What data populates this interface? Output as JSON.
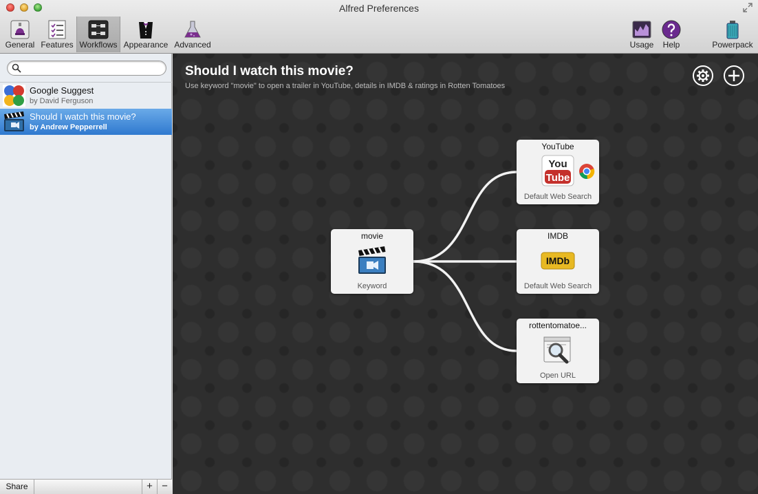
{
  "window": {
    "title": "Alfred Preferences"
  },
  "toolbar": {
    "general": "General",
    "features": "Features",
    "workflows": "Workflows",
    "appearance": "Appearance",
    "advanced": "Advanced",
    "usage": "Usage",
    "help": "Help",
    "powerpack": "Powerpack",
    "selected": "workflows"
  },
  "sidebar": {
    "search": {
      "value": "",
      "placeholder": ""
    },
    "items": [
      {
        "name": "Google Suggest",
        "author": "by David Ferguson"
      },
      {
        "name": "Should I watch this movie?",
        "author": "by Andrew Pepperrell",
        "selected": true
      }
    ],
    "share_label": "Share",
    "add_label": "+",
    "remove_label": "−"
  },
  "workflow": {
    "title": "Should I watch this movie?",
    "description": "Use keyword \"movie\" to open a trailer in YouTube, details in IMDB & ratings in Rotten Tomatoes",
    "nodes": [
      {
        "title": "movie",
        "type": "Keyword",
        "icon": "clapperboard-icon"
      },
      {
        "title": "YouTube",
        "type": "Default Web Search",
        "icon": "youtube-icon"
      },
      {
        "title": "IMDB",
        "type": "Default Web Search",
        "icon": "imdb-icon"
      },
      {
        "title": "rottentomatoe...",
        "type": "Open URL",
        "icon": "magnifier-icon"
      }
    ]
  },
  "icons": {
    "toolbar": [
      "general-icon",
      "features-icon",
      "workflows-icon",
      "appearance-icon",
      "advanced-icon",
      "usage-icon",
      "help-icon",
      "powerpack-icon"
    ],
    "canvas": [
      "gear-icon",
      "plus-circle-icon"
    ]
  },
  "colors": {
    "canvas": "#2e2e2e",
    "selection": "#3a82d6",
    "accent": "#7a3aa8"
  }
}
